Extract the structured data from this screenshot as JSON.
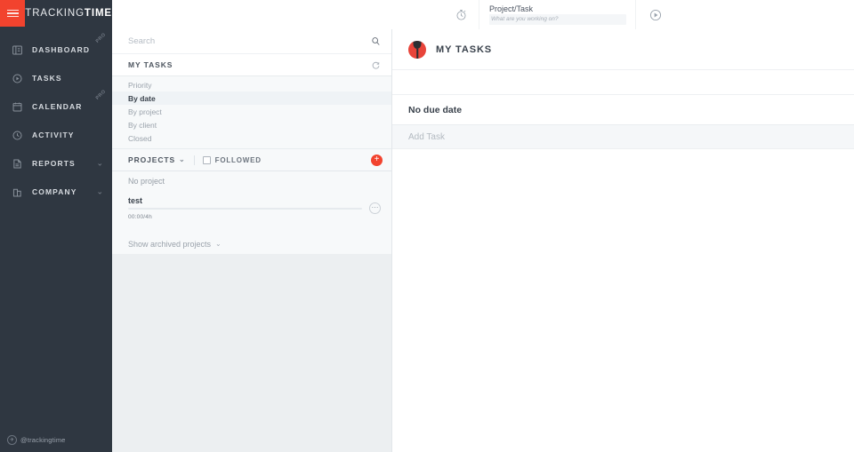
{
  "brand": {
    "name_light": "TRACKING",
    "name_bold": "TIME",
    "menu_icon": "hamburger-icon"
  },
  "sidebar": {
    "items": [
      {
        "label": "DASHBOARD",
        "icon": "dashboard-icon",
        "badge": "PRO",
        "caret": ""
      },
      {
        "label": "TASKS",
        "icon": "tasks-play-icon",
        "badge": "",
        "caret": ""
      },
      {
        "label": "CALENDAR",
        "icon": "calendar-icon",
        "badge": "PRO",
        "caret": ""
      },
      {
        "label": "ACTIVITY",
        "icon": "clock-icon",
        "badge": "",
        "caret": ""
      },
      {
        "label": "REPORTS",
        "icon": "report-doc-icon",
        "badge": "",
        "caret": "⌄"
      },
      {
        "label": "COMPANY",
        "icon": "building-icon",
        "badge": "",
        "caret": "⌄"
      }
    ],
    "footer": {
      "handle": "@trackingtime",
      "icon": "twitter-circle-icon"
    }
  },
  "topbar": {
    "stopwatch_icon": "stopwatch-icon",
    "project_task_label": "Project/Task",
    "task_placeholder": "What are you working on?",
    "play_icon": "play-circle-icon"
  },
  "middle": {
    "search": {
      "value": "",
      "placeholder": "Search",
      "icon": "search-icon"
    },
    "my_tasks": {
      "title": "MY TASKS",
      "refresh_icon": "refresh-icon"
    },
    "filters": [
      {
        "label": "Priority",
        "active": false
      },
      {
        "label": "By date",
        "active": true
      },
      {
        "label": "By project",
        "active": false
      },
      {
        "label": "By client",
        "active": false
      },
      {
        "label": "Closed",
        "active": false
      }
    ],
    "projects_header": {
      "title": "PROJECTS",
      "caret": "⌄",
      "followed_label": "FOLLOWED",
      "followed_checked": false,
      "add_label": "+",
      "add_color": "#f2432e"
    },
    "projects": [
      {
        "name": "No project",
        "type": "plain"
      }
    ],
    "project_rows": [
      {
        "name": "test",
        "time": "00:00/4h",
        "progress": 0,
        "more_icon": "more-dots-icon"
      }
    ],
    "archived": {
      "label": "Show archived projects",
      "caret": "⌄"
    }
  },
  "main": {
    "avatar": "user-avatar",
    "title": "MY TASKS",
    "due_section": "No due date",
    "add_task_placeholder": "Add Task"
  }
}
